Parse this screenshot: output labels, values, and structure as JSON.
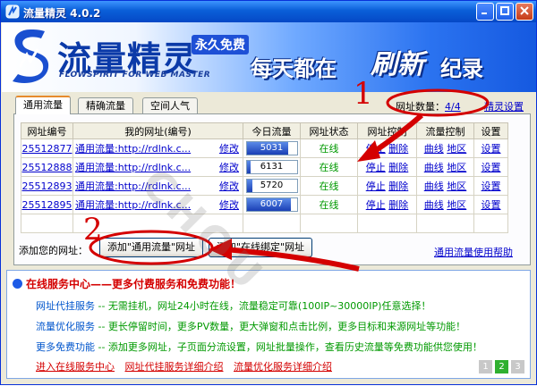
{
  "window": {
    "title": "流量精灵 4.0.2"
  },
  "banner": {
    "title": "流量精灵",
    "free": "永久免费",
    "subtitle": "FLOWSPIRIT FOR WEB MASTER",
    "slogan_a": "每天都在",
    "slogan_b": "刷新",
    "slogan_c": "纪录"
  },
  "tabs": [
    {
      "label": "通用流量",
      "active": true
    },
    {
      "label": "精确流量",
      "active": false
    },
    {
      "label": "空间人气",
      "active": false
    }
  ],
  "count": {
    "label": "网址数量：",
    "value": "4/4"
  },
  "settings_link": "精灵设置",
  "table": {
    "headers": [
      "网址编号",
      "我的网址(编号)",
      "今日流量",
      "网址状态",
      "网址控制",
      "流量控制",
      "设置"
    ],
    "rows": [
      {
        "id": "25512877",
        "url": "通用流量:http://rdlnk.c...",
        "edit": "修改",
        "traffic": "5031",
        "fill": 0.83,
        "status": "在线",
        "stop": "停止",
        "del": "删除",
        "curve": "曲线",
        "region": "地区",
        "set": "设置"
      },
      {
        "id": "25512888",
        "url": "通用流量:http://rdlnk.c...",
        "edit": "修改",
        "traffic": "6131",
        "fill": 0.08,
        "status": "在线",
        "stop": "停止",
        "del": "删除",
        "curve": "曲线",
        "region": "地区",
        "set": "设置"
      },
      {
        "id": "25512893",
        "url": "通用流量:http://rdlnk.c...",
        "edit": "修改",
        "traffic": "5720",
        "fill": 0.12,
        "status": "在线",
        "stop": "停止",
        "del": "删除",
        "curve": "曲线",
        "region": "地区",
        "set": "设置"
      },
      {
        "id": "25512895",
        "url": "通用流量:http://rdlnk.c...",
        "edit": "修改",
        "traffic": "6007",
        "fill": 0.88,
        "status": "在线",
        "stop": "停止",
        "del": "删除",
        "curve": "曲线",
        "region": "地区",
        "set": "设置"
      }
    ]
  },
  "add": {
    "label": "添加您的网址：",
    "btn_general": "添加\"通用流量\"网址",
    "btn_bound": "添加\"在线绑定\"网址"
  },
  "help_link": "通用流量使用帮助",
  "service": {
    "head": "在线服务中心——更多付费服务和免费功能！",
    "lines": [
      {
        "name": "网址代挂服务",
        "text": " -- 无需挂机，网址24小时在线，流量稳定可靠(100IP~30000IP)任意选择！"
      },
      {
        "name": "流量优化服务",
        "text": " -- 更长停留时间，更多PV数量，更大弹窗和点击比例，更多目标和来源网址等功能！"
      },
      {
        "name": "更多免费功能",
        "text": " -- 添加更多网址，子页面分流设置，网址批量操作，查看历史流量等免费功能供您使用！"
      }
    ],
    "links": [
      "进入在线服务中心",
      "网址代挂服务详细介绍",
      "流量优化服务详细介绍"
    ],
    "pager": [
      "1",
      "2",
      "3"
    ]
  },
  "annotations": {
    "n1": "1",
    "n2": "2",
    "watermark": "CHOU"
  },
  "colors": {
    "accent": "#d40000",
    "link": "#0000cc",
    "online": "#009900",
    "title_bar": "#0a5fd8"
  }
}
